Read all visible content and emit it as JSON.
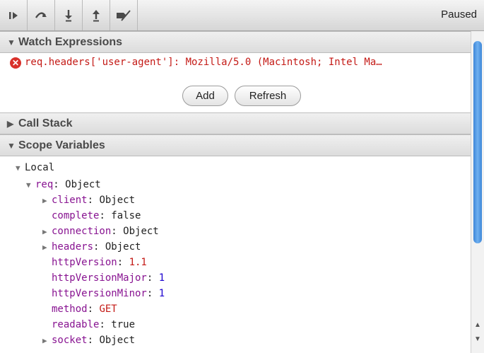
{
  "toolbar": {
    "buttons": [
      {
        "name": "resume-icon"
      },
      {
        "name": "step-over-icon"
      },
      {
        "name": "step-into-icon"
      },
      {
        "name": "step-out-icon"
      },
      {
        "name": "deactivate-breakpoints-icon"
      }
    ],
    "status": "Paused"
  },
  "watch": {
    "title": "Watch Expressions",
    "expression": "req.headers['user-agent']: Mozilla/5.0 (Macintosh; Intel Ma…",
    "add_label": "Add",
    "refresh_label": "Refresh"
  },
  "call_stack": {
    "title": "Call Stack"
  },
  "scope": {
    "title": "Scope Variables",
    "local_label": "Local",
    "req_key": "req",
    "req_value": "Object",
    "props": [
      {
        "key": "client",
        "value": "Object",
        "expandable": true,
        "vtype": "plain"
      },
      {
        "key": "complete",
        "value": "false",
        "expandable": false,
        "vtype": "plain"
      },
      {
        "key": "connection",
        "value": "Object",
        "expandable": true,
        "vtype": "plain"
      },
      {
        "key": "headers",
        "value": "Object",
        "expandable": true,
        "vtype": "plain"
      },
      {
        "key": "httpVersion",
        "value": "1.1",
        "expandable": false,
        "vtype": "str"
      },
      {
        "key": "httpVersionMajor",
        "value": "1",
        "expandable": false,
        "vtype": "num"
      },
      {
        "key": "httpVersionMinor",
        "value": "1",
        "expandable": false,
        "vtype": "num"
      },
      {
        "key": "method",
        "value": "GET",
        "expandable": false,
        "vtype": "str"
      },
      {
        "key": "readable",
        "value": "true",
        "expandable": false,
        "vtype": "plain"
      },
      {
        "key": "socket",
        "value": "Object",
        "expandable": true,
        "vtype": "plain"
      }
    ]
  },
  "colors": {
    "error": "#d9312b",
    "property_key": "#881391",
    "string_value": "#c41a16",
    "number_value": "#1c00cf",
    "scroll_thumb": "#3d86d8"
  }
}
